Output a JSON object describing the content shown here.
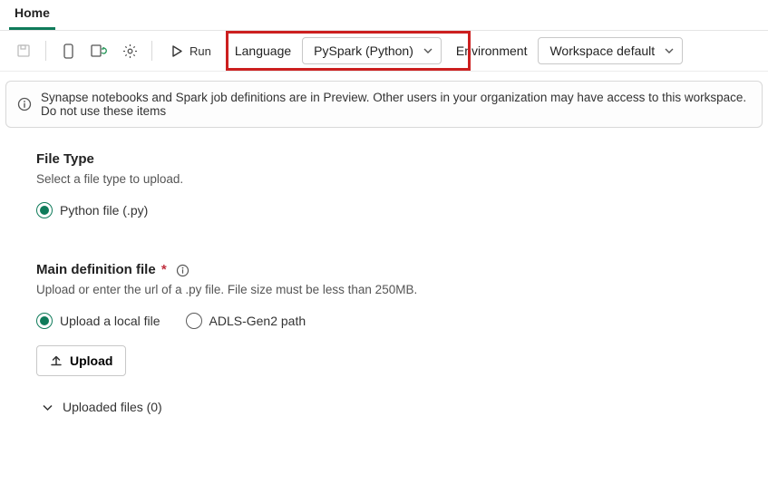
{
  "tabs": {
    "active": "Home"
  },
  "toolbar": {
    "run_label": "Run",
    "language_label": "Language",
    "language_value": "PySpark (Python)",
    "environment_label": "Environment",
    "environment_value": "Workspace default"
  },
  "banner": {
    "text": "Synapse notebooks and Spark job definitions are in Preview. Other users in your organization may have access to this workspace. Do not use these items"
  },
  "filetype": {
    "title": "File Type",
    "desc": "Select a file type to upload.",
    "option_python": "Python file (.py)",
    "option_python_checked": true
  },
  "maindef": {
    "title": "Main definition file",
    "desc": "Upload or enter the url of a .py file. File size must be less than 250MB.",
    "option_upload": "Upload a local file",
    "option_adls": "ADLS-Gen2 path",
    "selected": "upload",
    "upload_btn": "Upload",
    "disclosure_label": "Uploaded files (0)"
  }
}
